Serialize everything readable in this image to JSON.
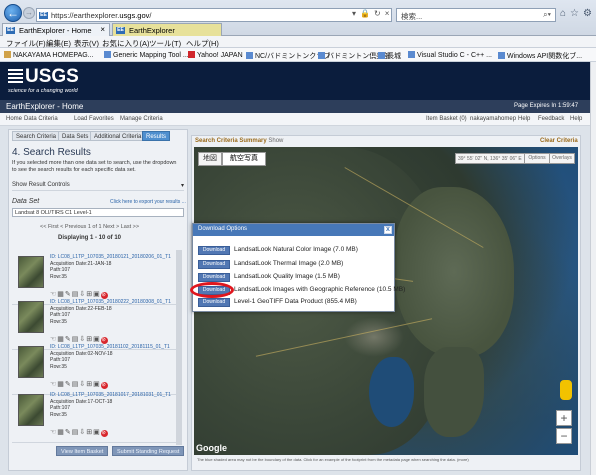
{
  "browser": {
    "url_prefix": "https://earthexplorer.",
    "url_domain": "usgs.gov",
    "url_suffix": "/",
    "search_placeholder": "検索...",
    "tabs": [
      {
        "label": "EarthExplorer - Home",
        "active": true
      },
      {
        "label": "EarthExplorer",
        "active": false
      }
    ],
    "menu": [
      "ファイル(F)",
      "編集(E)",
      "表示(V)",
      "お気に入り(A)",
      "ツール(T)",
      "ヘルプ(H)"
    ],
    "favorites": [
      "NAKAYAMA HOMEPAG...",
      "Generic Mapping Tool ...",
      "Yahoo! JAPAN",
      "NC/バドミントンクラブ",
      "バドミントン倶楽部",
      "長城",
      "Visual Studio C - C++ ...",
      "Windows API関数化ブ..."
    ]
  },
  "usgs": {
    "logo_word": "USGS",
    "tagline": "science for a changing world",
    "app_title": "EarthExplorer - Home",
    "expire": "Page Expires In 1:59:47",
    "nav": [
      "Home",
      "Data Criteria",
      "Load Favorites",
      "Manage Criteria"
    ],
    "user_nav": [
      "Item Basket (0)",
      "nakayamahomep",
      "Help",
      "Feedback",
      "Help"
    ]
  },
  "left": {
    "subtabs": [
      "Search Criteria",
      "Data Sets",
      "Additional Criteria",
      "Results"
    ],
    "results_title": "4. Search Results",
    "help_text": "If you selected more than one data set to search, use the dropdown to see the search results for each specific data set.",
    "show_controls": "Show Result Controls",
    "dataset_label": "Data Set",
    "dataset_link": "Click here to export your results ...",
    "dataset_value": "Landsat 8 OLI/TIRS C1 Level-1",
    "pager": "<< First  < Previous   1  of 1   Next >  Last >>",
    "displaying": "Displaying 1 - 10 of 10",
    "results": [
      {
        "id": "ID: LC08_L1TP_107035_20180121_20180206_01_T1",
        "date": "Acquisition Date:21-JAN-18",
        "path": "Path:107",
        "row": "Row:35"
      },
      {
        "id": "ID: LC08_L1TP_107035_20180222_20180308_01_T1",
        "date": "Acquisition Date:22-FEB-18",
        "path": "Path:107",
        "row": "Row:35"
      },
      {
        "id": "ID: LC08_L1TP_107035_20181102_20181115_01_T1",
        "date": "Acquisition Date:02-NOV-18",
        "path": "Path:107",
        "row": "Row:35"
      },
      {
        "id": "ID: LC08_L1TP_107035_20181017_20181031_01_T1",
        "date": "Acquisition Date:17-OCT-18",
        "path": "Path:107",
        "row": "Row:35"
      }
    ],
    "bottom_buttons": [
      "View Item Basket",
      "Submit Standing Request"
    ]
  },
  "right": {
    "summary_title": "Search Criteria Summary",
    "summary_show": "Show",
    "clear": "Clear Criteria",
    "map_btn_map": "地図",
    "map_btn_sat": "航空写真",
    "coords": "39° 55' 02\" N, 136° 35' 06\" E",
    "opt1": "Options",
    "opt2": "Overlays",
    "google": "Google",
    "footer": "The blue shaded area may not be the boundary of the data. Click for an example of the footprint from the metadata page when searching the data. (more)"
  },
  "modal": {
    "title": "Download Options",
    "close": "x",
    "button_label": "Download",
    "items": [
      "LandsatLook Natural Color Image (7.0 MB)",
      "LandsatLook Thermal Image (2.0 MB)",
      "LandsatLook Quality Image (1.5 MB)",
      "LandsatLook Images with Geographic Reference (10.5 MB)",
      "Level-1 GeoTIFF Data Product (855.4 MB)"
    ]
  },
  "colors": {
    "usgs_header": "#0b1d3d",
    "modal_header": "#4778b8",
    "highlight": "#e0161e"
  }
}
